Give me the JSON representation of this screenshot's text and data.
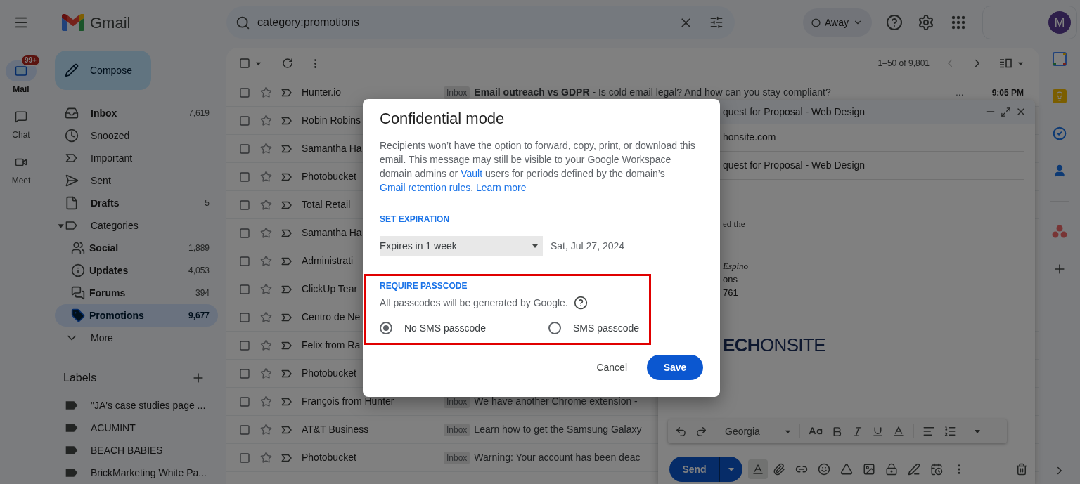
{
  "app_bar": {
    "product": "Gmail",
    "search": {
      "value": "category:promotions"
    },
    "status": {
      "label": "Away"
    },
    "avatar": {
      "initial": "M"
    }
  },
  "rail": [
    {
      "kind": "mail",
      "label": "Mail",
      "selected": true,
      "badge": "99+"
    },
    {
      "kind": "chat",
      "label": "Chat",
      "selected": false
    },
    {
      "kind": "meet",
      "label": "Meet",
      "selected": false
    }
  ],
  "compose_button": {
    "label": "Compose"
  },
  "folders": [
    {
      "kind": "inbox",
      "label": "Inbox",
      "count": "7,619",
      "unread": true,
      "selected": false
    },
    {
      "kind": "snoozed",
      "label": "Snoozed",
      "unread": false,
      "selected": false
    },
    {
      "kind": "important",
      "label": "Important",
      "unread": false,
      "selected": false
    },
    {
      "kind": "sent",
      "label": "Sent",
      "unread": false,
      "selected": false
    },
    {
      "kind": "drafts",
      "label": "Drafts",
      "count": "5",
      "unread": true,
      "selected": false
    },
    {
      "kind": "categories",
      "label": "Categories",
      "unread": false,
      "selected": false,
      "expanded": true,
      "children": [
        {
          "kind": "social",
          "label": "Social",
          "count": "1,889",
          "unread": true,
          "selected": false
        },
        {
          "kind": "updates",
          "label": "Updates",
          "count": "4,053",
          "unread": true,
          "selected": false
        },
        {
          "kind": "forums",
          "label": "Forums",
          "count": "394",
          "unread": true,
          "selected": false
        },
        {
          "kind": "promotions",
          "label": "Promotions",
          "count": "9,677",
          "unread": true,
          "selected": true
        }
      ]
    },
    {
      "kind": "more",
      "label": "More",
      "unread": false,
      "selected": false
    }
  ],
  "labels": {
    "title": "Labels",
    "items": [
      "\"JA's case studies page ...",
      "ACUMINT",
      "BEACH BABIES",
      "BrickMarketing White Pa..."
    ]
  },
  "list_toolbar": {
    "range": "1–50 of 9,801",
    "prev_disabled": true,
    "all_selected": false
  },
  "messages": [
    {
      "sender": "Hunter.io",
      "selected": false,
      "tag": "Inbox",
      "subject": "**Email outreach vs GDPR** - Is cold email legal? And how can you stay compliant?",
      "more": "...",
      "time": "9:05 PM"
    },
    {
      "sender": "Robin Robins",
      "selected": false
    },
    {
      "sender": "Samantha Ha",
      "selected": false
    },
    {
      "sender": "Photobucket",
      "selected": false
    },
    {
      "sender": "Total Retail",
      "selected": false
    },
    {
      "sender": "Samantha Ha",
      "selected": false
    },
    {
      "sender": "Administrati",
      "selected": false
    },
    {
      "sender": "ClickUp Tear",
      "selected": false
    },
    {
      "sender": "Centro de Ne",
      "selected": false
    },
    {
      "sender": "Felix from Ra",
      "selected": false
    },
    {
      "sender": "Photobucket",
      "selected": false
    },
    {
      "sender": "François from Hunter",
      "selected": false,
      "tag": "Inbox",
      "subject": "We have another Chrome extension -"
    },
    {
      "sender": "AT&T Business",
      "selected": false,
      "tag": "Inbox",
      "subject": "Learn how to get the Samsung Galaxy"
    },
    {
      "sender": "Photobucket",
      "selected": false,
      "tag": "Inbox",
      "subject": "Warning: Your account has been deac"
    }
  ],
  "compose": {
    "title": "quest for Proposal - Web Design",
    "recipient": "honsite.com",
    "subject": "quest for Proposal - Web Design",
    "body": [
      {
        "kind": "serif",
        "text": "ed the"
      },
      {
        "kind": "serif_italic",
        "text": "Espino"
      },
      {
        "kind": "plain",
        "text": "ons"
      },
      {
        "kind": "plain",
        "text": "761"
      }
    ],
    "logo": "**ECH**ONSITE",
    "font": "Georgia",
    "send": "Send",
    "formatting_on": true
  },
  "dialog": {
    "title": "Confidential mode",
    "description": [
      {
        "kind": "text",
        "text": "Recipients won’t have the option to forward, copy, print, or download this email. This message may still be visible to your Google Workspace domain admins or "
      },
      {
        "kind": "link",
        "text": "Vault"
      },
      {
        "kind": "text",
        "text": " users for periods defined by the domain’s "
      },
      {
        "kind": "link",
        "text": "Gmail retention rules"
      },
      {
        "kind": "text",
        "text": ". "
      },
      {
        "kind": "link",
        "text": "Learn more"
      }
    ],
    "expiration": {
      "heading": "SET EXPIRATION",
      "value": "Expires in 1 week",
      "date": "Sat, Jul 27, 2024"
    },
    "passcode": {
      "heading": "REQUIRE PASSCODE",
      "hint": "All passcodes will be generated by Google.",
      "highlighted": true,
      "options": [
        {
          "label": "No SMS passcode",
          "selected": true
        },
        {
          "label": "SMS passcode",
          "selected": false
        }
      ]
    },
    "buttons": [
      {
        "kind": "secondary",
        "label": "Cancel"
      },
      {
        "kind": "primary",
        "label": "Save"
      }
    ]
  }
}
